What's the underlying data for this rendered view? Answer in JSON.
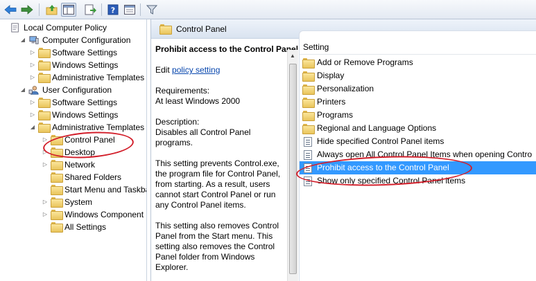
{
  "toolbar": {
    "buttons": [
      "back-icon",
      "forward-icon",
      "up-folder-icon",
      "show-hide-tree-icon",
      "export-list-icon",
      "help-icon",
      "properties-view-icon",
      "filter-icon"
    ]
  },
  "tree": {
    "items": [
      {
        "label": "Local Computer Policy"
      },
      {
        "label": "Computer Configuration"
      },
      {
        "label": "Software Settings"
      },
      {
        "label": "Windows Settings"
      },
      {
        "label": "Administrative Templates"
      },
      {
        "label": "User Configuration"
      },
      {
        "label": "Software Settings"
      },
      {
        "label": "Windows Settings"
      },
      {
        "label": "Administrative Templates"
      },
      {
        "label": "Control Panel"
      },
      {
        "label": "Desktop"
      },
      {
        "label": "Network"
      },
      {
        "label": "Shared Folders"
      },
      {
        "label": "Start Menu and Taskba"
      },
      {
        "label": "System"
      },
      {
        "label": "Windows Component"
      },
      {
        "label": "All Settings"
      }
    ]
  },
  "middle": {
    "header": "Control Panel",
    "policy_title": "Prohibit access to the Control Panel",
    "edit_prefix": "Edit",
    "edit_link": "policy setting",
    "requirements_label": "Requirements:",
    "requirements_value": "At least Windows 2000",
    "description_label": "Description:",
    "description_line": "Disables all Control Panel programs.",
    "para1": "This setting prevents Control.exe, the program file for Control Panel, from starting. As a result, users cannot start Control Panel or run any Control Panel items.",
    "para2": "This setting also removes Control Panel from the Start menu. This setting also removes the Control Panel folder from Windows Explorer."
  },
  "right": {
    "column_header": "Setting",
    "rows": [
      {
        "label": "Add or Remove Programs",
        "icon": "folder-icon"
      },
      {
        "label": "Display",
        "icon": "folder-icon"
      },
      {
        "label": "Personalization",
        "icon": "folder-icon"
      },
      {
        "label": "Printers",
        "icon": "folder-icon"
      },
      {
        "label": "Programs",
        "icon": "folder-icon"
      },
      {
        "label": "Regional and Language Options",
        "icon": "folder-icon"
      },
      {
        "label": "Hide specified Control Panel items",
        "icon": "setting-icon"
      },
      {
        "label": "Always open All Control Panel Items when opening Contro",
        "icon": "setting-icon"
      },
      {
        "label": "Prohibit access to the Control Panel",
        "icon": "setting-icon"
      },
      {
        "label": "Show only specified Control Panel items",
        "icon": "setting-icon"
      }
    ],
    "selected_index": 8
  },
  "colors": {
    "selection": "#3399ff",
    "annotation": "#d21e2a",
    "link": "#0645ad"
  }
}
